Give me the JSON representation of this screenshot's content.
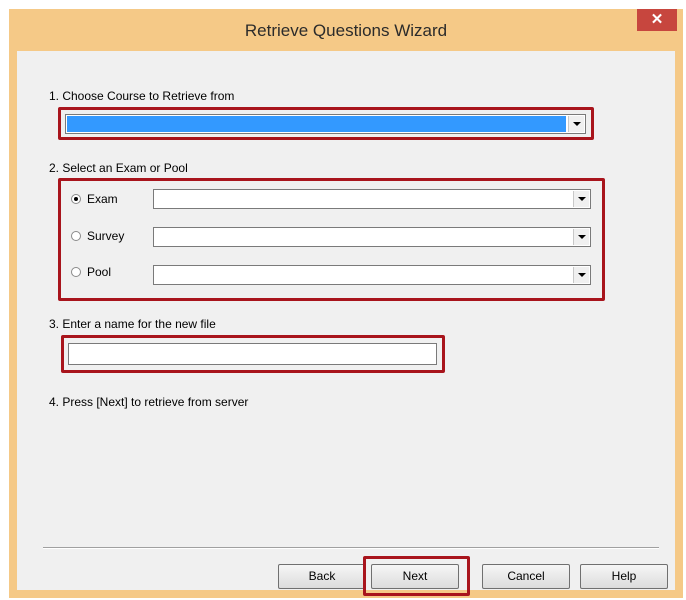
{
  "window": {
    "title": "Retrieve Questions Wizard",
    "close_glyph": "✕"
  },
  "step1": {
    "label": "1.  Choose Course to Retrieve from",
    "course_value": ""
  },
  "step2": {
    "label": "2.  Select an Exam or Pool",
    "options": [
      {
        "label": "Exam",
        "checked": true,
        "value": ""
      },
      {
        "label": "Survey",
        "checked": false,
        "value": ""
      },
      {
        "label": "Pool",
        "checked": false,
        "value": ""
      }
    ]
  },
  "step3": {
    "label": "3.  Enter a name for the new file",
    "value": ""
  },
  "step4": {
    "label": "4.  Press [Next] to retrieve from server"
  },
  "buttons": {
    "back": "Back",
    "next": "Next",
    "cancel": "Cancel",
    "help": "Help"
  },
  "colors": {
    "highlight": "#a8141c",
    "titlebar": "#f5c987",
    "selection": "#3399ff",
    "close": "#c7463e"
  }
}
